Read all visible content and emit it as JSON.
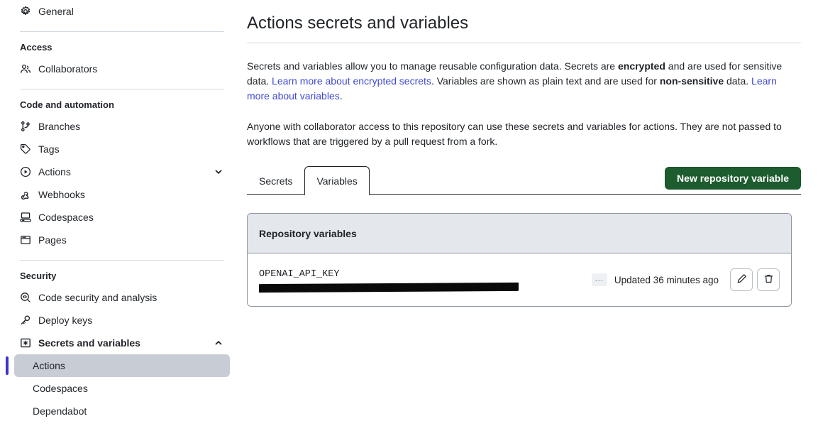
{
  "sidebar": {
    "top_items": [
      {
        "label": "General",
        "icon": "gear-icon"
      }
    ],
    "sections": [
      {
        "title": "Access",
        "items": [
          {
            "label": "Collaborators",
            "icon": "people-icon"
          }
        ]
      },
      {
        "title": "Code and automation",
        "items": [
          {
            "label": "Branches",
            "icon": "branch-icon"
          },
          {
            "label": "Tags",
            "icon": "tag-icon"
          },
          {
            "label": "Actions",
            "icon": "play-icon",
            "chevron": "chevron-down-icon"
          },
          {
            "label": "Webhooks",
            "icon": "webhook-icon"
          },
          {
            "label": "Codespaces",
            "icon": "codespaces-icon"
          },
          {
            "label": "Pages",
            "icon": "browser-icon"
          }
        ]
      },
      {
        "title": "Security",
        "items": [
          {
            "label": "Code security and analysis",
            "icon": "code-scan-icon"
          },
          {
            "label": "Deploy keys",
            "icon": "key-icon"
          },
          {
            "label": "Secrets and variables",
            "icon": "asterisk-box-icon",
            "chevron": "chevron-up-icon",
            "bold": true
          }
        ]
      }
    ],
    "sub_items": [
      {
        "label": "Actions",
        "active": true
      },
      {
        "label": "Codespaces",
        "active": false
      },
      {
        "label": "Dependabot",
        "active": false
      }
    ]
  },
  "main": {
    "page_title": "Actions secrets and variables",
    "paragraph1": {
      "p1": "Secrets and variables allow you to manage reusable configuration data. Secrets are ",
      "b1": "encrypted",
      "p2": " and are used for sensitive data. ",
      "link1": "Learn more about encrypted secrets",
      "p3": ". Variables are shown as plain text and are used for ",
      "b2": "non-sensitive",
      "p4": " data. ",
      "link2": "Learn more about variables",
      "p5": "."
    },
    "paragraph2": "Anyone with collaborator access to this repository can use these secrets and variables for actions. They are not passed to workflows that are triggered by a pull request from a fork.",
    "tabs": [
      {
        "label": "Secrets",
        "active": false
      },
      {
        "label": "Variables",
        "active": true
      }
    ],
    "new_button": "New repository variable",
    "panel": {
      "header": "Repository variables",
      "rows": [
        {
          "name": "OPENAI_API_KEY",
          "value_redacted": true,
          "truncation": "...",
          "updated": "Updated 36 minutes ago",
          "edit_icon": "pencil-icon",
          "delete_icon": "trash-icon"
        }
      ]
    }
  },
  "colors": {
    "accent_green": "#1c5c2e",
    "link_blue": "#4049d4",
    "active_bar_blue": "#3d34cf",
    "active_bg": "#c8ccd4",
    "panel_header_bg": "#e4e8ed",
    "border": "#8b949e"
  }
}
